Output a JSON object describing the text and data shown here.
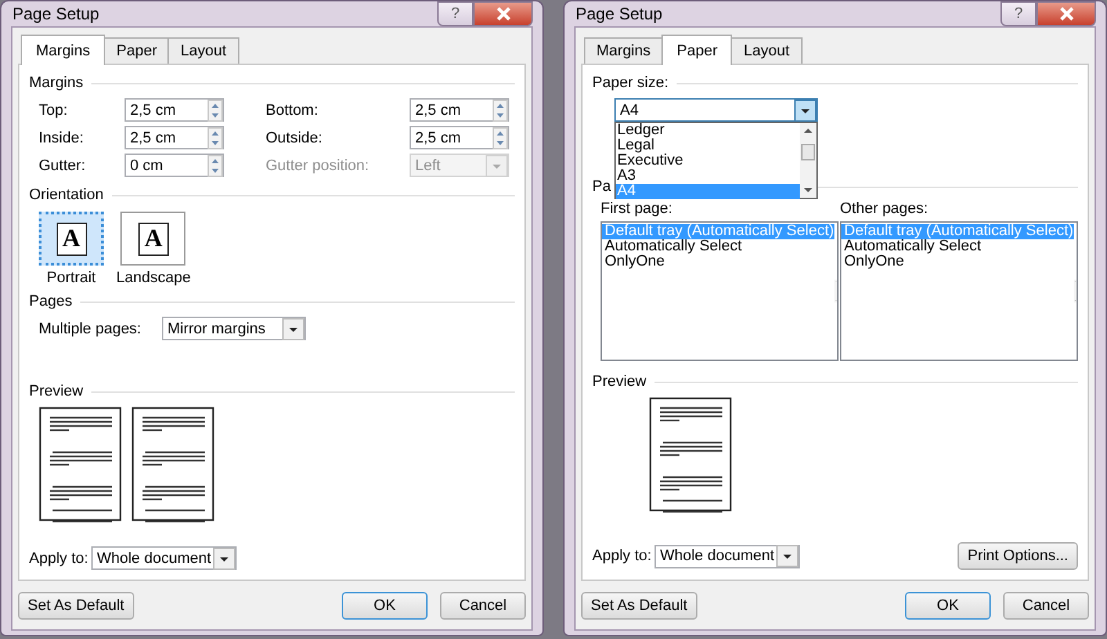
{
  "dialogs": [
    {
      "title": "Page Setup",
      "help_button": "?",
      "tabs": [
        {
          "label": "Margins",
          "selected": true
        },
        {
          "label": "Paper",
          "selected": false
        },
        {
          "label": "Layout",
          "selected": false
        }
      ],
      "panel": {
        "kind": "margins",
        "margins_heading": "Margins",
        "margin_fields": [
          {
            "label": "Top:",
            "value": "2,5 cm",
            "kind": "spin",
            "disabled": false
          },
          {
            "label": "Bottom:",
            "value": "2,5 cm",
            "kind": "spin",
            "disabled": false
          },
          {
            "label": "Inside:",
            "value": "2,5 cm",
            "kind": "spin",
            "disabled": false
          },
          {
            "label": "Outside:",
            "value": "2,5 cm",
            "kind": "spin",
            "disabled": false
          },
          {
            "label": "Gutter:",
            "value": "0 cm",
            "kind": "spin",
            "disabled": false
          },
          {
            "label": "Gutter position:",
            "value": "Left",
            "kind": "select",
            "disabled": true
          }
        ],
        "orientation_heading": "Orientation",
        "orientations": [
          {
            "label": "Portrait",
            "icon_letter": "A",
            "selected": true
          },
          {
            "label": "Landscape",
            "icon_letter": "A",
            "selected": false
          }
        ],
        "pages_heading": "Pages",
        "multiple_pages": {
          "label": "Multiple pages:",
          "value": "Mirror margins"
        }
      },
      "preview": {
        "heading": "Preview",
        "pages": [
          {
            "kind": "page"
          },
          {
            "kind": "page"
          }
        ]
      },
      "apply_to": {
        "label": "Apply to:",
        "value": "Whole document"
      },
      "buttons": [
        {
          "label": "Set As Default",
          "kind": "left"
        },
        {
          "label": "OK",
          "kind": "default"
        },
        {
          "label": "Cancel",
          "kind": "normal"
        }
      ]
    },
    {
      "title": "Page Setup",
      "help_button": "?",
      "tabs": [
        {
          "label": "Margins",
          "selected": false
        },
        {
          "label": "Paper",
          "selected": true
        },
        {
          "label": "Layout",
          "selected": false
        }
      ],
      "panel": {
        "kind": "paper",
        "paper_size": {
          "label": "Paper size:",
          "value": "A4",
          "expanded": true,
          "options": [
            {
              "label": "Ledger",
              "selected": false
            },
            {
              "label": "Legal",
              "selected": false
            },
            {
              "label": "Executive",
              "selected": false
            },
            {
              "label": "A3",
              "selected": false
            },
            {
              "label": "A4",
              "selected": true
            }
          ]
        },
        "paper_source_heading": "Pa",
        "trays": [
          {
            "label": "First page:",
            "items": [
              {
                "label": "Default tray (Automatically Select)",
                "selected": true
              },
              {
                "label": "Automatically Select",
                "selected": false
              },
              {
                "label": "OnlyOne",
                "selected": false
              }
            ]
          },
          {
            "label": "Other pages:",
            "items": [
              {
                "label": "Default tray (Automatically Select)",
                "selected": true
              },
              {
                "label": "Automatically Select",
                "selected": false
              },
              {
                "label": "OnlyOne",
                "selected": false
              }
            ]
          }
        ]
      },
      "preview": {
        "heading": "Preview",
        "pages": [
          {
            "kind": "page"
          }
        ]
      },
      "apply_to": {
        "label": "Apply to:",
        "value": "Whole document"
      },
      "print_options": "Print Options...",
      "buttons": [
        {
          "label": "Set As Default",
          "kind": "left"
        },
        {
          "label": "OK",
          "kind": "default"
        },
        {
          "label": "Cancel",
          "kind": "normal"
        }
      ]
    }
  ]
}
